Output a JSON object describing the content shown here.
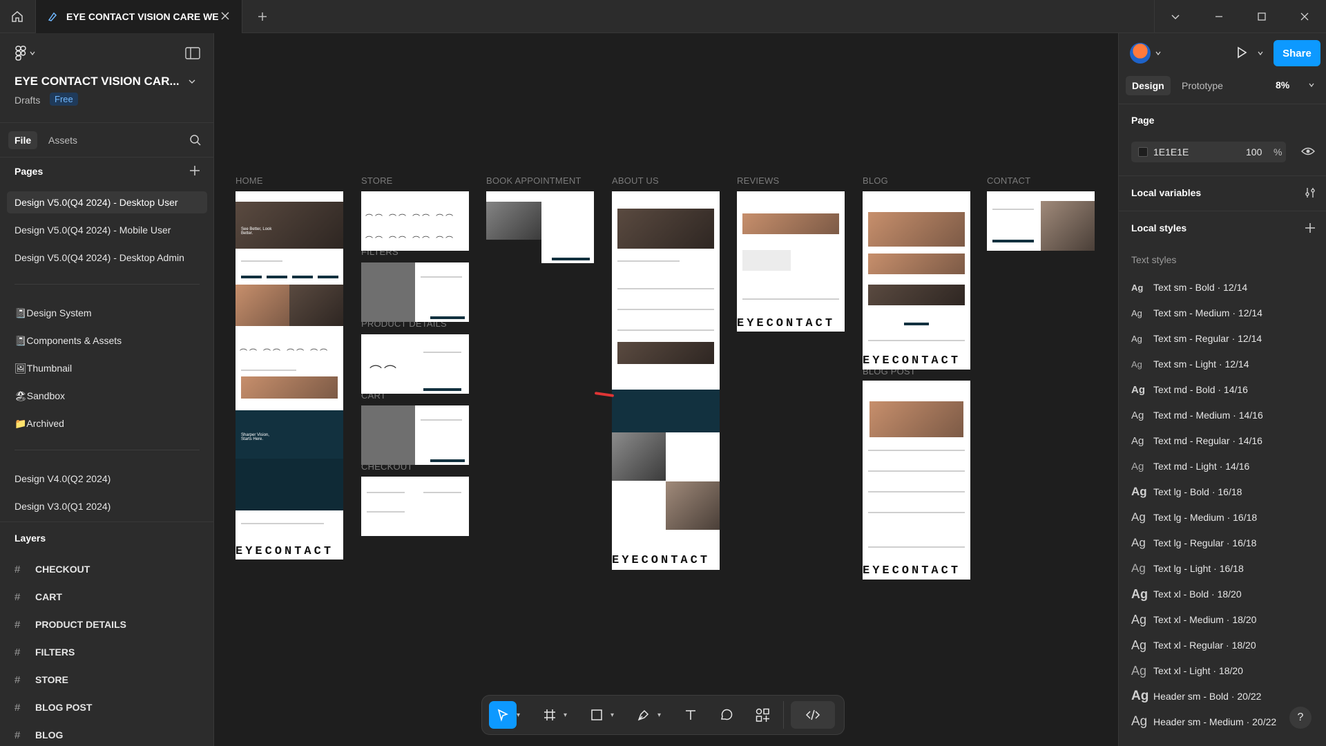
{
  "tabbar": {
    "tab_title": "EYE CONTACT VISION CARE WE",
    "home_icon": "home-icon",
    "close_icon": "close-icon"
  },
  "left_panel": {
    "file_name": "EYE CONTACT VISION CAR...",
    "drafts_label": "Drafts",
    "plan_badge": "Free",
    "tabs": [
      "File",
      "Assets"
    ],
    "pages_title": "Pages",
    "pages": [
      "Design V5.0(Q4 2024) - Desktop User",
      "Design V5.0(Q4 2024) - Mobile User",
      "Design V5.0(Q4 2024) - Desktop Admin",
      "📓Design System",
      "📓Components & Assets",
      "🖼Thumbnail",
      "🏖Sandbox",
      "📁Archived",
      "Design V4.0(Q2 2024)",
      "Design V3.0(Q1 2024)"
    ],
    "layers_title": "Layers",
    "layers": [
      "CHECKOUT",
      "CART",
      "PRODUCT DETAILS",
      "FILTERS",
      "STORE",
      "BLOG POST",
      "BLOG"
    ]
  },
  "canvas": {
    "background": "#1E1E1E",
    "frame_labels": [
      "HOME",
      "STORE",
      "BOOK APPOINTMENT",
      "ABOUT US",
      "REVIEWS",
      "BLOG",
      "CONTACT",
      "FILTERS",
      "PRODUCT DETAILS",
      "CART",
      "CHECKOUT",
      "BLOG POST"
    ],
    "hero_text_1": "See Better, Look Better.",
    "hero_text_2": "Sharper Vision, Starts Here.",
    "wordmark": "EYECONTACT"
  },
  "right_panel": {
    "share_label": "Share",
    "tabs": [
      "Design",
      "Prototype"
    ],
    "zoom": "8%",
    "page_title": "Page",
    "page_color_hex": "1E1E1E",
    "page_opacity": "100",
    "percent_sign": "%",
    "local_variables": "Local variables",
    "local_styles": "Local styles",
    "text_styles_label": "Text styles",
    "text_styles": [
      "Text sm - Bold · 12/14",
      "Text sm - Medium · 12/14",
      "Text sm - Regular · 12/14",
      "Text sm - Light · 12/14",
      "Text md - Bold · 14/16",
      "Text md - Medium · 14/16",
      "Text md - Regular · 14/16",
      "Text md - Light · 14/16",
      "Text lg - Bold · 16/18",
      "Text lg - Medium · 16/18",
      "Text lg - Regular · 16/18",
      "Text lg - Light · 16/18",
      "Text xl - Bold · 18/20",
      "Text xl - Medium · 18/20",
      "Text xl - Regular · 18/20",
      "Text xl - Light · 18/20",
      "Header sm - Bold · 20/22",
      "Header sm - Medium · 20/22"
    ],
    "ag_glyph": "Ag",
    "help": "?"
  },
  "colors": {
    "accent": "#0D99FF",
    "panel": "#2C2C2C",
    "canvas": "#1E1E1E",
    "brand_teal": "#12313F"
  }
}
